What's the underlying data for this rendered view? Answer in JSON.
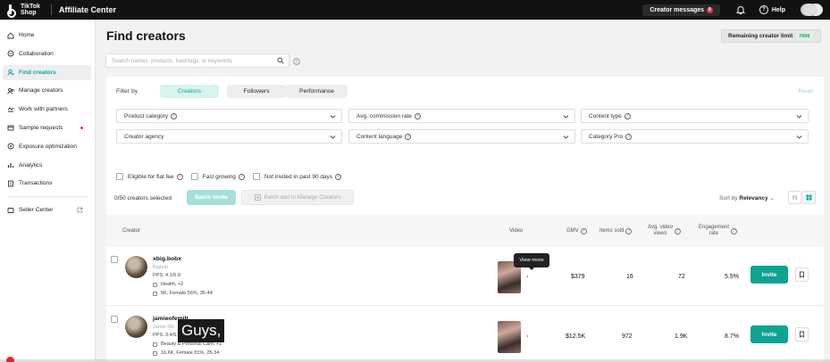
{
  "topbar": {
    "logo_text": "TikTok Shop",
    "app_title": "Affiliate Center",
    "creator_messages": "Creator messages",
    "messages_badge": "9",
    "help": "Help"
  },
  "sidebar": {
    "items": [
      {
        "label": "Home",
        "icon": "home-icon"
      },
      {
        "label": "Collaboration",
        "icon": "collaboration-icon"
      },
      {
        "label": "Find creators",
        "icon": "find-creators-icon",
        "active": true
      },
      {
        "label": "Manage creators",
        "icon": "manage-creators-icon"
      },
      {
        "label": "Work with partners",
        "icon": "partners-icon"
      },
      {
        "label": "Sample requests",
        "icon": "samples-icon",
        "dot": true
      },
      {
        "label": "Exposure optimization",
        "icon": "exposure-icon"
      },
      {
        "label": "Analytics",
        "icon": "analytics-icon"
      },
      {
        "label": "Transactions",
        "icon": "transactions-icon"
      }
    ],
    "seller_center": "Seller Center"
  },
  "page": {
    "title": "Find creators",
    "limit_label": "Remaining creator limit",
    "limit_value": "7000"
  },
  "search": {
    "placeholder": "Search names, products, hashtags, or keywords"
  },
  "filters": {
    "filter_by": "Filter by",
    "tabs": [
      "Creators",
      "Followers",
      "Performance"
    ],
    "active_tab": "Creators",
    "reset": "Reset",
    "dropdowns": [
      "Product category",
      "Avg. commission rate",
      "Content type",
      "Creator agency",
      "Content language",
      "Category Pro"
    ],
    "checkboxes": [
      "Eligible for flat fee",
      "Fast growing",
      "Not invited in past 90 days"
    ]
  },
  "table": {
    "selected": "0/50 creators selected",
    "batch_invite": "Batch invite",
    "batch_add": "Batch add to Manage Creators",
    "sort_label": "Sort by",
    "sort_value": "Relevancy",
    "headers": {
      "creator": "Creator",
      "video": "Video",
      "gmv": "GMV",
      "items_sold": "Items sold",
      "avg_views_1": "Avg. video",
      "avg_views_2": "views",
      "engagement_1": "Engagement",
      "engagement_2": "rate"
    },
    "rows": [
      {
        "name": "xbig.bobx",
        "handle": "Bigbob",
        "pps": "PPS: 4.1/5.0",
        "category": "Health, +2",
        "demo": "5K, Female 56%, 35-44",
        "gmv": "$379",
        "items_sold": "16",
        "views": "72",
        "engagement": "5.5%",
        "invite": "Invite"
      },
      {
        "name": "jamieofemilt",
        "handle": "Jamie Sto",
        "pps": "PPS: 3.4/5.0",
        "category": "Beauty & Personal Care, +1",
        "demo": "16.6K, Female 81%, 25-34",
        "gmv": "$12.5K",
        "items_sold": "972",
        "views": "1.9K",
        "engagement": "8.7%",
        "invite": "Invite"
      }
    ]
  },
  "tooltip": "View more",
  "caption": "Guys,"
}
